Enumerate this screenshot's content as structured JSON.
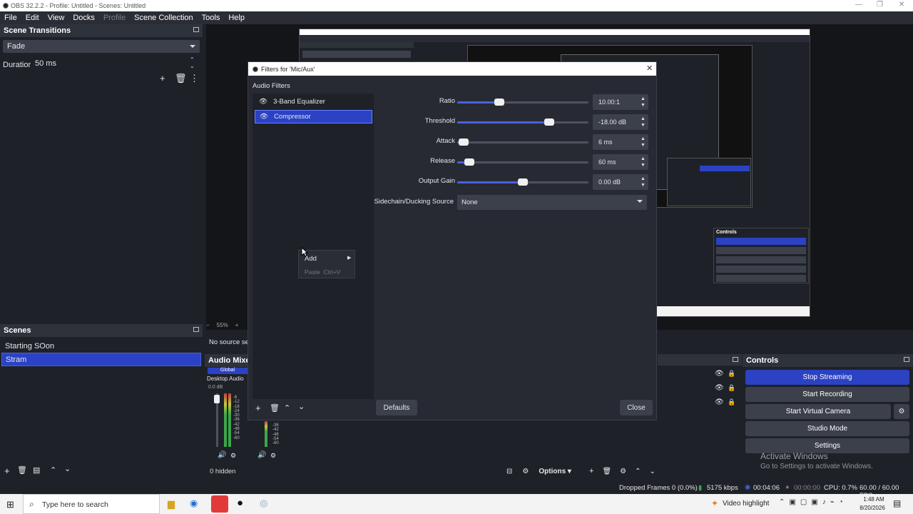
{
  "window": {
    "title": "OBS 32.2.2 - Profile: Untitled - Scenes: Untitled"
  },
  "menu": [
    {
      "label": "File",
      "dim": false
    },
    {
      "label": "Edit",
      "dim": false
    },
    {
      "label": "View",
      "dim": false
    },
    {
      "label": "Docks",
      "dim": false
    },
    {
      "label": "Profile",
      "dim": true
    },
    {
      "label": "Scene Collection",
      "dim": false
    },
    {
      "label": "Tools",
      "dim": false
    },
    {
      "label": "Help",
      "dim": false
    }
  ],
  "transitions": {
    "header": "Scene Transitions",
    "type": "Fade",
    "duration_label": "Duration",
    "duration_value": "50 ms"
  },
  "scenes": {
    "header": "Scenes",
    "items": [
      {
        "label": "Starting SOon",
        "selected": false
      },
      {
        "label": "Stram",
        "selected": true
      }
    ]
  },
  "preview": {
    "zoom": "55%"
  },
  "sources": {
    "empty_text": "No source sel",
    "hidden_text": "0 hidden"
  },
  "mixer": {
    "header": "Audio Mixer",
    "global_label": "Global",
    "channel_name": "Desktop Audio",
    "db_value": "0.0 dB",
    "scale": [
      "-6",
      "-12",
      "-18",
      "-24",
      "-30",
      "-36",
      "-42",
      "-48",
      "-54",
      "-60"
    ],
    "scale2": [
      "-36",
      "-42",
      "-48",
      "-54",
      "-60"
    ]
  },
  "bottom_toolbar": {
    "options_label": "Options"
  },
  "controls": {
    "header": "Controls",
    "buttons": [
      {
        "label": "Stop Streaming",
        "active": true
      },
      {
        "label": "Start Recording",
        "active": false
      },
      {
        "label": "Start Virtual Camera",
        "active": false
      },
      {
        "label": "Studio Mode",
        "active": false
      },
      {
        "label": "Settings",
        "active": false
      }
    ]
  },
  "activate_windows": {
    "title": "Activate Windows",
    "subtitle": "Go to Settings to activate Windows."
  },
  "filters_dialog": {
    "title": "Filters for 'Mic/Aux'",
    "section_label": "Audio Filters",
    "filters": [
      {
        "name": "3-Band Equalizer",
        "selected": false
      },
      {
        "name": "Compressor",
        "selected": true
      }
    ],
    "params": [
      {
        "label": "Ratio",
        "value": "10.00:1",
        "level_percent": 32
      },
      {
        "label": "Threshold",
        "value": "-18.00 dB",
        "level_percent": 70
      },
      {
        "label": "Attack",
        "value": "6 ms",
        "level_percent": 5
      },
      {
        "label": "Release",
        "value": "60 ms",
        "level_percent": 9
      },
      {
        "label": "Output Gain",
        "value": "0.00 dB",
        "level_percent": 50
      }
    ],
    "sidechain_label": "Sidechain/Ducking Source",
    "sidechain_value": "None",
    "defaults_label": "Defaults",
    "close_label": "Close"
  },
  "context_menu": {
    "add_label": "Add",
    "paste_label": "Paste",
    "paste_shortcut": "Ctrl+V"
  },
  "statusbar": {
    "dropped": "Dropped Frames 0 (0.0%)",
    "bitrate": "5175 kbps",
    "stream_time": "00:04:06",
    "rec_time": "00:00:00",
    "cpu": "CPU: 0.7%",
    "fps": "60.00 / 60.00 FPS"
  },
  "taskbar": {
    "search_placeholder": "Type here to search",
    "tray_label": "Video highlight",
    "time": "1:48 AM",
    "date": "8/20/2026"
  },
  "colors": {
    "accent": "#2b42c4",
    "panel": "#1e2128",
    "header": "#2e323b",
    "field": "#3c404b"
  }
}
